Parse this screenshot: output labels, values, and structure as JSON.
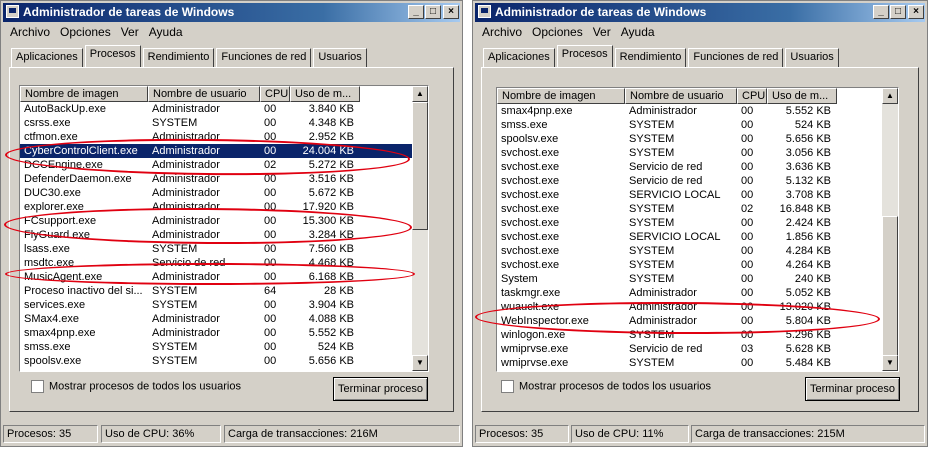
{
  "left": {
    "title": "Administrador de tareas de Windows",
    "menu": [
      "Archivo",
      "Opciones",
      "Ver",
      "Ayuda"
    ],
    "tabs": [
      "Aplicaciones",
      "Procesos",
      "Rendimiento",
      "Funciones de red",
      "Usuarios"
    ],
    "active_tab": 1,
    "columns": [
      "Nombre de imagen",
      "Nombre de usuario",
      "CPU",
      "Uso de m..."
    ],
    "rows": [
      [
        "AutoBackUp.exe",
        "Administrador",
        "00",
        "3.840 KB"
      ],
      [
        "csrss.exe",
        "SYSTEM",
        "00",
        "4.348 KB"
      ],
      [
        "ctfmon.exe",
        "Administrador",
        "00",
        "2.952 KB"
      ],
      [
        "CyberControlClient.exe",
        "Administrador",
        "00",
        "24.004 KB"
      ],
      [
        "DCCEngine.exe",
        "Administrador",
        "02",
        "5.272 KB"
      ],
      [
        "DefenderDaemon.exe",
        "Administrador",
        "00",
        "3.516 KB"
      ],
      [
        "DUC30.exe",
        "Administrador",
        "00",
        "5.672 KB"
      ],
      [
        "explorer.exe",
        "Administrador",
        "00",
        "17.920 KB"
      ],
      [
        "FCsupport.exe",
        "Administrador",
        "00",
        "15.300 KB"
      ],
      [
        "FlyGuard.exe",
        "Administrador",
        "00",
        "3.284 KB"
      ],
      [
        "lsass.exe",
        "SYSTEM",
        "00",
        "7.560 KB"
      ],
      [
        "msdtc.exe",
        "Servicio de red",
        "00",
        "4.468 KB"
      ],
      [
        "MusicAgent.exe",
        "Administrador",
        "00",
        "6.168 KB"
      ],
      [
        "Proceso inactivo del si...",
        "SYSTEM",
        "64",
        "28 KB"
      ],
      [
        "services.exe",
        "SYSTEM",
        "00",
        "3.904 KB"
      ],
      [
        "SMax4.exe",
        "Administrador",
        "00",
        "4.088 KB"
      ],
      [
        "smax4pnp.exe",
        "Administrador",
        "00",
        "5.552 KB"
      ],
      [
        "smss.exe",
        "SYSTEM",
        "00",
        "524 KB"
      ],
      [
        "spoolsv.exe",
        "SYSTEM",
        "00",
        "5.656 KB"
      ]
    ],
    "selected_row": 3,
    "show_all_label": "Mostrar procesos de todos los usuarios",
    "end_button": "Terminar proceso",
    "status": [
      "Procesos: 35",
      "Uso de CPU: 36%",
      "Carga de transacciones: 216M"
    ]
  },
  "right": {
    "title": "Administrador de tareas de Windows",
    "menu": [
      "Archivo",
      "Opciones",
      "Ver",
      "Ayuda"
    ],
    "tabs": [
      "Aplicaciones",
      "Procesos",
      "Rendimiento",
      "Funciones de red",
      "Usuarios"
    ],
    "active_tab": 1,
    "columns": [
      "Nombre de imagen",
      "Nombre de usuario",
      "CPU",
      "Uso de m..."
    ],
    "rows": [
      [
        "smax4pnp.exe",
        "Administrador",
        "00",
        "5.552 KB"
      ],
      [
        "smss.exe",
        "SYSTEM",
        "00",
        "524 KB"
      ],
      [
        "spoolsv.exe",
        "SYSTEM",
        "00",
        "5.656 KB"
      ],
      [
        "svchost.exe",
        "SYSTEM",
        "00",
        "3.056 KB"
      ],
      [
        "svchost.exe",
        "Servicio de red",
        "00",
        "3.636 KB"
      ],
      [
        "svchost.exe",
        "Servicio de red",
        "00",
        "5.132 KB"
      ],
      [
        "svchost.exe",
        "SERVICIO LOCAL",
        "00",
        "3.708 KB"
      ],
      [
        "svchost.exe",
        "SYSTEM",
        "02",
        "16.848 KB"
      ],
      [
        "svchost.exe",
        "SYSTEM",
        "00",
        "2.424 KB"
      ],
      [
        "svchost.exe",
        "SERVICIO LOCAL",
        "00",
        "1.856 KB"
      ],
      [
        "svchost.exe",
        "SYSTEM",
        "00",
        "4.284 KB"
      ],
      [
        "svchost.exe",
        "SYSTEM",
        "00",
        "4.264 KB"
      ],
      [
        "System",
        "SYSTEM",
        "00",
        "240 KB"
      ],
      [
        "taskmgr.exe",
        "Administrador",
        "00",
        "5.052 KB"
      ],
      [
        "wuauclt.exe",
        "Administrador",
        "00",
        "13.020 KB"
      ],
      [
        "WebInspector.exe",
        "Administrador",
        "00",
        "5.804 KB"
      ],
      [
        "winlogon.exe",
        "SYSTEM",
        "00",
        "5.296 KB"
      ],
      [
        "wmiprvse.exe",
        "Servicio de red",
        "03",
        "5.628 KB"
      ],
      [
        "wmiprvse.exe",
        "SYSTEM",
        "00",
        "5.484 KB"
      ]
    ],
    "selected_row": -1,
    "show_all_label": "Mostrar procesos de todos los usuarios",
    "end_button": "Terminar proceso",
    "status": [
      "Procesos: 35",
      "Uso de CPU: 11%",
      "Carga de transacciones: 215M"
    ]
  }
}
